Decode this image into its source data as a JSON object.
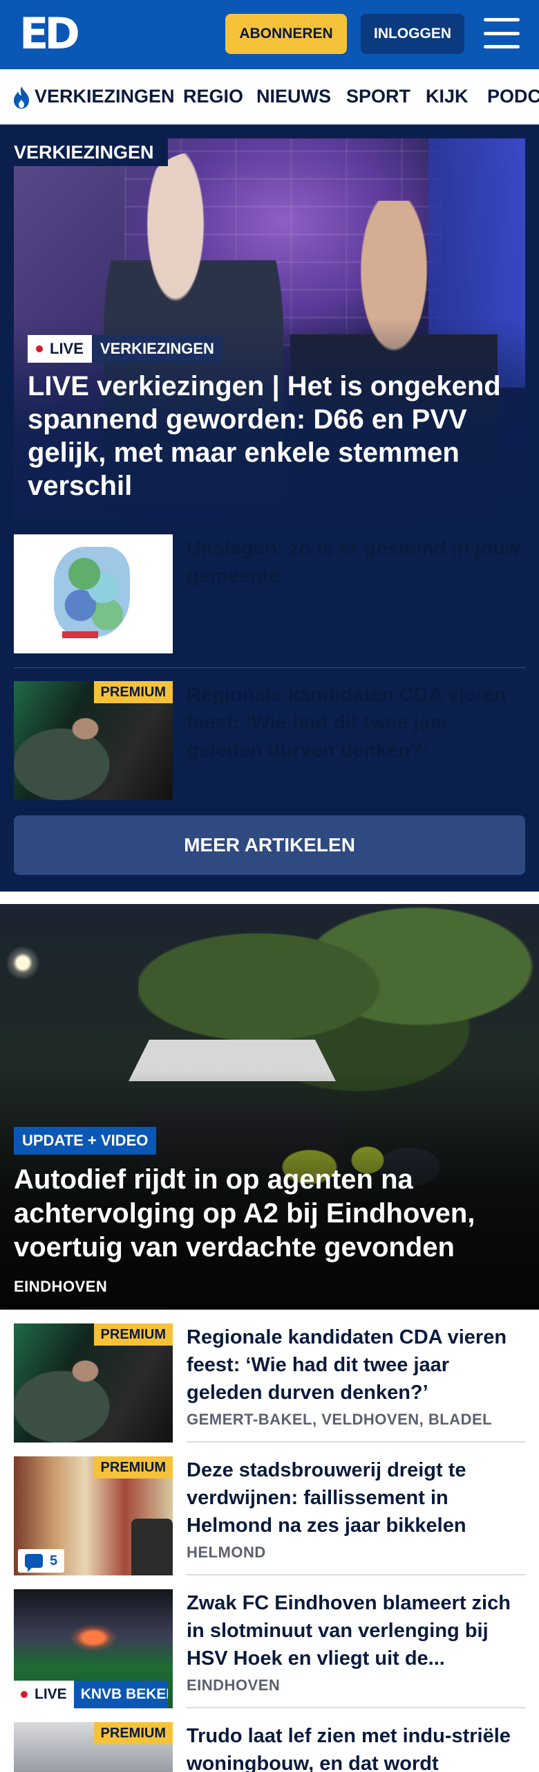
{
  "header": {
    "logo": "ED",
    "subscribe_label": "ABONNEREN",
    "login_label": "INLOGGEN"
  },
  "nav": {
    "items": [
      "VERKIEZINGEN",
      "REGIO",
      "NIEUWS",
      "SPORT",
      "KIJK",
      "PODCASTS"
    ]
  },
  "election_section": {
    "label": "VERKIEZINGEN",
    "hero": {
      "live_label": "LIVE",
      "tag": "VERKIEZINGEN",
      "title": "LIVE verkiezingen | Het is ongekend spannend geworden: D66 en PVV gelijk, met maar enkele stemmen verschil"
    },
    "articles": [
      {
        "title": "Uitslagen: zo is er gestemd in jouw gemeente"
      },
      {
        "badge": "PREMIUM",
        "title": "Regionale kandidaten CDA vieren feest: ‘Wie had dit twee jaar geleden durven denken?’"
      }
    ],
    "more_label": "MEER ARTIKELEN"
  },
  "hero2": {
    "badge": "UPDATE + VIDEO",
    "title": "Autodief rijdt in op agenten na achtervolging op A2 bij Eindhoven, voertuig van verdachte gevonden",
    "location": "EINDHOVEN"
  },
  "list": [
    {
      "badge": "PREMIUM",
      "title": "Regionale kandidaten CDA vieren feest: ‘Wie had dit twee jaar geleden durven denken?’",
      "location": "GEMERT-BAKEL, VELDHOVEN, BLADEL"
    },
    {
      "badge": "PREMIUM",
      "title": "Deze stadsbrouwerij dreigt te verdwijnen: faillissement in Helmond na zes jaar bikkelen",
      "location": "HELMOND",
      "comments": "5"
    },
    {
      "title": "Zwak FC Eindhoven blameert zich in slotminuut van verlenging bij HSV Hoek en vliegt uit de...",
      "location": "EINDHOVEN",
      "live_label": "LIVE",
      "tag": "KNVB BEKER"
    },
    {
      "badge": "PREMIUM",
      "title": "Trudo laat lef zien met indu-striële woningbouw, en dat wordt"
    }
  ],
  "colors": {
    "brand_blue": "#0a57b6",
    "dark_navy": "#0b1f4d",
    "premium_yellow": "#f6c23a",
    "live_red": "#d01c2a"
  }
}
